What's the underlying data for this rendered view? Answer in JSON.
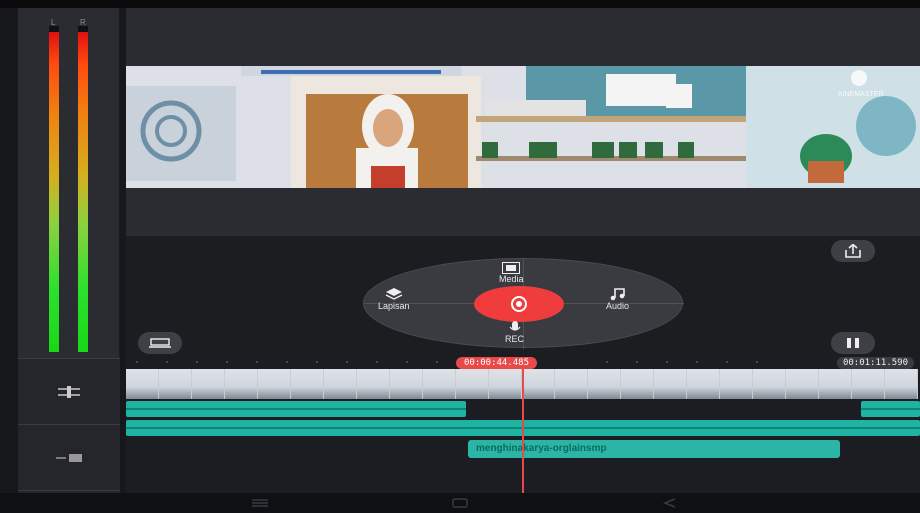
{
  "meter": {
    "left_label": "L",
    "right_label": "R",
    "left_level": 0.95,
    "right_level": 0.95
  },
  "wheel": {
    "media_label": "Media",
    "layer_label": "Lapisan",
    "audio_label": "Audio",
    "rec_label": "REC"
  },
  "preview": {
    "watermark": "KINEMASTER"
  },
  "timeline": {
    "current_time": "00:00:44.485",
    "total_time": "00:01:11.590",
    "text_clip": "menghinakarya-orglainsmp"
  },
  "icons": {
    "share": "share-icon",
    "pause": "pause-icon",
    "screen": "screen-icon",
    "adjust": "adjust-icon",
    "record": "camera-shutter-icon"
  },
  "colors": {
    "accent": "#f03c3c",
    "audio": "#1fb3a3"
  }
}
